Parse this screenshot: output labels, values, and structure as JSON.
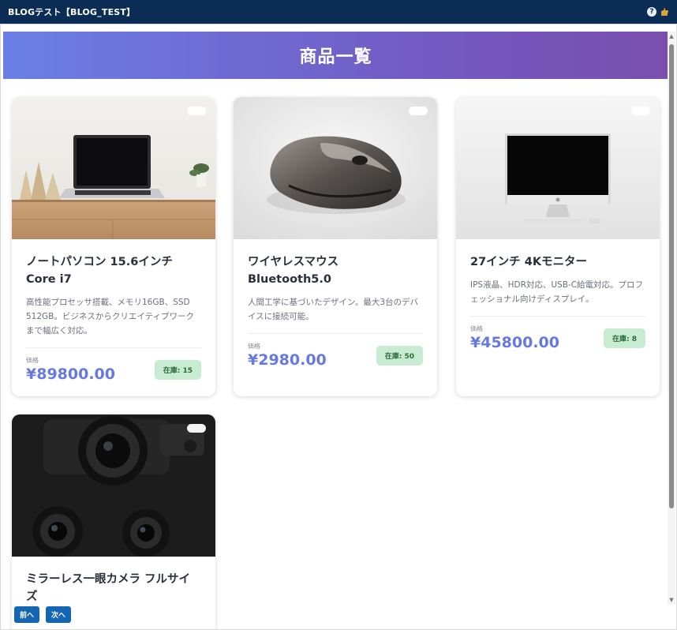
{
  "window": {
    "title": "BLOGテスト【BLOG_TEST】",
    "help_icon": "?"
  },
  "header": {
    "title": "商品一覧"
  },
  "products": [
    {
      "name": "ノートパソコン 15.6インチ Core i7",
      "description": "高性能プロセッサ搭載、メモリ16GB、SSD 512GB。ビジネスからクリエイティブワークまで幅広く対応。",
      "price_label": "価格",
      "price": "¥89800.00",
      "stock": "在庫: 15",
      "image": "laptop-photo"
    },
    {
      "name": "ワイヤレスマウス Bluetooth5.0",
      "description": "人間工学に基づいたデザイン。最大3台のデバイスに接続可能。",
      "price_label": "価格",
      "price": "¥2980.00",
      "stock": "在庫: 50",
      "image": "mouse-photo"
    },
    {
      "name": "27インチ 4Kモニター",
      "description": "IPS液晶、HDR対応、USB-C給電対応。プロフェッショナル向けディスプレイ。",
      "price_label": "価格",
      "price": "¥45800.00",
      "stock": "在庫: 8",
      "image": "monitor-photo"
    },
    {
      "name": "ミラーレス一眼カメラ フルサイズ",
      "image": "camera-photo"
    }
  ],
  "pager": {
    "prev_label": "前へ",
    "next_label": "次へ"
  },
  "colors": {
    "titlebar": "#0b2d55",
    "accent": "#6679df",
    "stock_badge": "#c8ecd1",
    "pager_button": "#1565b5"
  }
}
